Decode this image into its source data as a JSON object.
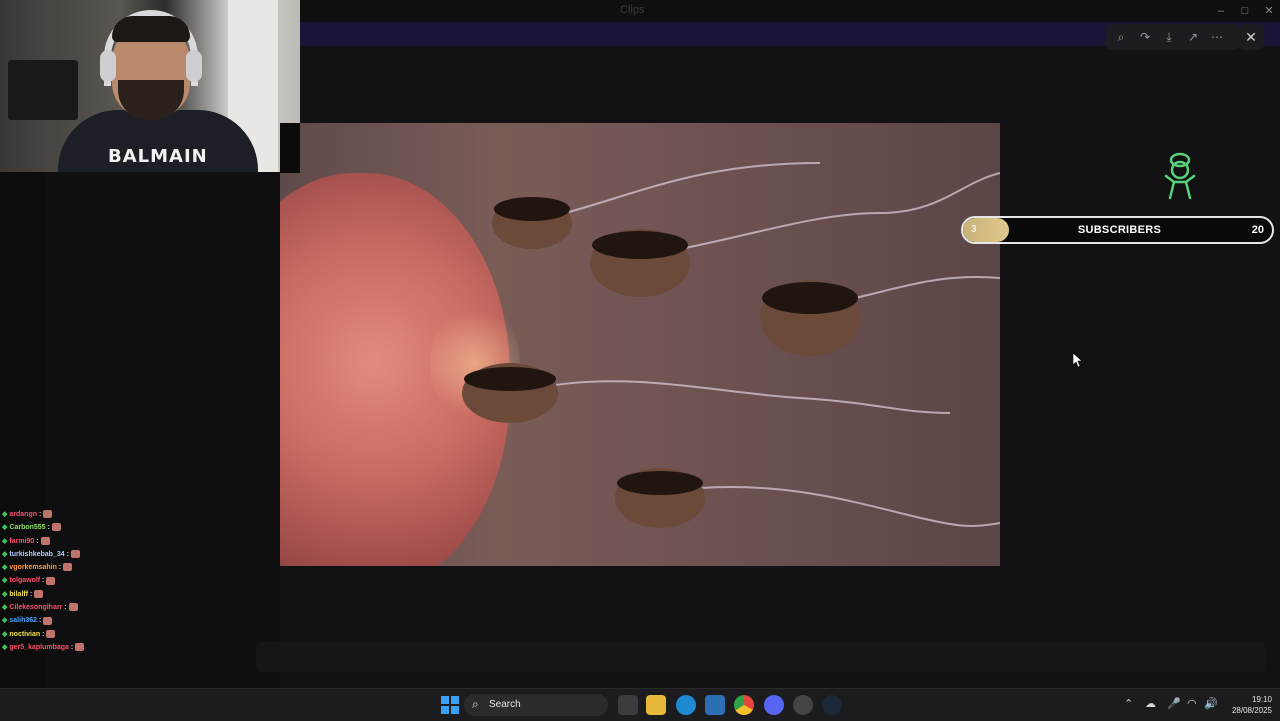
{
  "background_app": {
    "window_title": "Clips",
    "banner_text": "",
    "channel_title": "",
    "channels": []
  },
  "webcam": {
    "shirt_text": "BALMAIN"
  },
  "chat": {
    "messages": [
      {
        "user": "ardangn",
        "color": "#ff4d6d"
      },
      {
        "user": "Carbon555",
        "color": "#8fe36a"
      },
      {
        "user": "farmi90",
        "color": "#ff4d6d"
      },
      {
        "user": "turkishkebab_34",
        "color": "#b7c7ff"
      },
      {
        "user": "vgorkemsahin",
        "color": "#ff9c3a"
      },
      {
        "user": "tolgawolf",
        "color": "#ff4d6d"
      },
      {
        "user": "bilalff",
        "color": "#f2e04a"
      },
      {
        "user": "Cilekesongiharr",
        "color": "#ff4d6d"
      },
      {
        "user": "salih362",
        "color": "#4aa3ff"
      },
      {
        "user": "noctivian",
        "color": "#f2e04a"
      },
      {
        "user": "ger5_kaplumbaga",
        "color": "#ff4d6d"
      }
    ]
  },
  "viewer": {
    "toolbar": {
      "zoom_icon": "zoom-icon",
      "forward_icon": "forward-icon",
      "download_icon": "download-icon",
      "open_icon": "open-external-icon",
      "more_icon": "more-icon"
    },
    "close_icon": "close-icon"
  },
  "goal_widget": {
    "current": "3",
    "label": "SUBSCRIBERS",
    "target": "20",
    "progress_fraction": 0.15,
    "accent_color": "#c9b27a"
  },
  "taskbar": {
    "search_label": "Search",
    "clock_time": "19:10",
    "clock_date": "28/08/2025"
  }
}
